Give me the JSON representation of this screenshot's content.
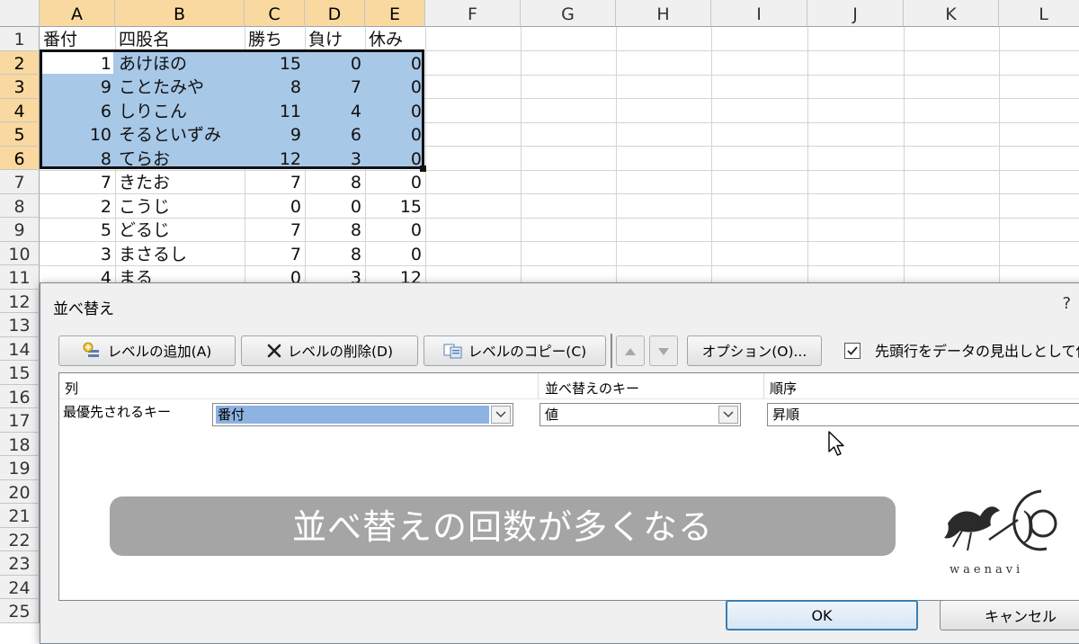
{
  "spreadsheet": {
    "columns": [
      "A",
      "B",
      "C",
      "D",
      "E",
      "F",
      "G",
      "H",
      "I",
      "J",
      "K",
      "L"
    ],
    "rows": [
      "1",
      "2",
      "3",
      "4",
      "5",
      "6",
      "7",
      "8",
      "9",
      "10",
      "11",
      "12",
      "13",
      "14",
      "15",
      "16",
      "17",
      "18",
      "19",
      "20",
      "21",
      "22",
      "23",
      "24",
      "25"
    ],
    "header_row": {
      "a": "番付",
      "b": "四股名",
      "c": "勝ち",
      "d": "負け",
      "e": "休み"
    },
    "data": [
      {
        "a": "1",
        "b": "あけほの",
        "c": "15",
        "d": "0",
        "e": "0"
      },
      {
        "a": "9",
        "b": "ことたみや",
        "c": "8",
        "d": "7",
        "e": "0"
      },
      {
        "a": "6",
        "b": "しりこん",
        "c": "11",
        "d": "4",
        "e": "0"
      },
      {
        "a": "10",
        "b": "そるといずみ",
        "c": "9",
        "d": "6",
        "e": "0"
      },
      {
        "a": "8",
        "b": "てらお",
        "c": "12",
        "d": "3",
        "e": "0"
      },
      {
        "a": "7",
        "b": "きたお",
        "c": "7",
        "d": "8",
        "e": "0"
      },
      {
        "a": "2",
        "b": "こうじ",
        "c": "0",
        "d": "0",
        "e": "15"
      },
      {
        "a": "5",
        "b": "どるじ",
        "c": "7",
        "d": "8",
        "e": "0"
      },
      {
        "a": "3",
        "b": "まさるし",
        "c": "7",
        "d": "8",
        "e": "0"
      },
      {
        "a": "4",
        "b": "まる",
        "c": "0",
        "d": "3",
        "e": "12"
      }
    ]
  },
  "dialog": {
    "title": "並べ替え",
    "help": "?",
    "add_level": "レベルの追加(A)",
    "delete_level": "レベルの削除(D)",
    "copy_level": "レベルのコピー(C)",
    "options": "オプション(O)...",
    "header_checkbox_label": "先頭行をデータの見出しとして使",
    "col_header_column": "列",
    "col_header_sort_on": "並べ替えのキー",
    "col_header_order": "順序",
    "row_label": "最優先されるキー",
    "sort_column_value": "番付",
    "sort_on_value": "値",
    "order_value": "昇順",
    "ok": "OK",
    "cancel": "キャンセル"
  },
  "overlay": {
    "caption": "並べ替えの回数が多くなる",
    "logo_text": "waenavi"
  },
  "colors": {
    "selection": "#a8c8e8",
    "header_selected": "#f9d99f",
    "banner": "#a5a5a5"
  }
}
